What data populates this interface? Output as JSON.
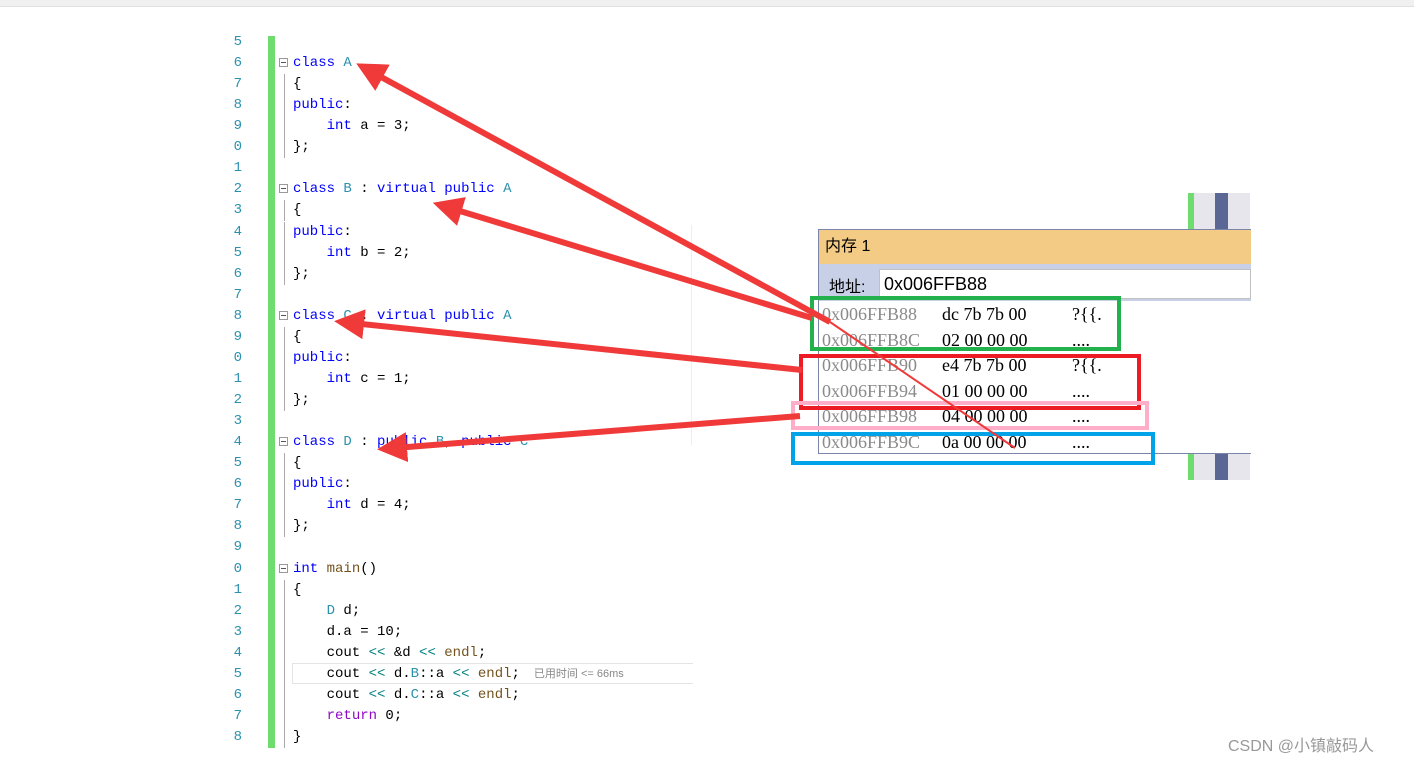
{
  "editor": {
    "lines": [
      {
        "n": "5",
        "html": ""
      },
      {
        "n": "6",
        "html": "<span class='kw'>class</span> <span class='ty'>A</span>",
        "fold": true
      },
      {
        "n": "7",
        "html": "{"
      },
      {
        "n": "8",
        "html": "<span class='kw'>public</span>:"
      },
      {
        "n": "9",
        "html": "    <span class='kw'>int</span> a = 3;"
      },
      {
        "n": "0",
        "html": "};"
      },
      {
        "n": "1",
        "html": ""
      },
      {
        "n": "2",
        "html": "<span class='kw'>class</span> <span class='ty'>B</span> : <span class='kw'>virtual</span> <span class='kw'>public</span> <span class='ty'>A</span>",
        "fold": true
      },
      {
        "n": "3",
        "html": "{"
      },
      {
        "n": "4",
        "html": "<span class='kw'>public</span>:"
      },
      {
        "n": "5",
        "html": "    <span class='kw'>int</span> b = 2;"
      },
      {
        "n": "6",
        "html": "};"
      },
      {
        "n": "7",
        "html": ""
      },
      {
        "n": "8",
        "html": "<span class='kw'>class</span> <span class='ty'>C</span> : <span class='kw'>virtual</span> <span class='kw'>public</span> <span class='ty'>A</span>",
        "fold": true
      },
      {
        "n": "9",
        "html": "{"
      },
      {
        "n": "0",
        "html": "<span class='kw'>public</span>:"
      },
      {
        "n": "1",
        "html": "    <span class='kw'>int</span> c = 1;"
      },
      {
        "n": "2",
        "html": "};"
      },
      {
        "n": "3",
        "html": ""
      },
      {
        "n": "4",
        "html": "<span class='kw'>class</span> <span class='ty'>D</span> : <span class='kw'>public</span> <span class='ty'>B</span>, <span class='kw'>public</span> <span class='ty'>C</span>",
        "fold": true
      },
      {
        "n": "5",
        "html": "{"
      },
      {
        "n": "6",
        "html": "<span class='kw'>public</span>:"
      },
      {
        "n": "7",
        "html": "    <span class='kw'>int</span> d = 4;"
      },
      {
        "n": "8",
        "html": "};"
      },
      {
        "n": "9",
        "html": ""
      },
      {
        "n": "0",
        "html": "<span class='kw'>int</span> <span class='fn'>main</span>()",
        "fold": true
      },
      {
        "n": "1",
        "html": "{"
      },
      {
        "n": "2",
        "html": "    <span class='ty'>D</span> d;"
      },
      {
        "n": "3",
        "html": "    d.a = 10;"
      },
      {
        "n": "4",
        "html": "    cout <span class='op'>&lt;&lt;</span> &amp;d <span class='op'>&lt;&lt;</span> <span class='fn'>endl</span>;"
      },
      {
        "n": "5",
        "html": "    cout <span class='op'>&lt;&lt;</span> d.<span class='ty'>B</span>::a <span class='op'>&lt;&lt;</span> <span class='fn'>endl</span>;",
        "hint": "已用时间 <= 66ms"
      },
      {
        "n": "6",
        "html": "    cout <span class='op'>&lt;&lt;</span> d.<span class='ty'>C</span>::a <span class='op'>&lt;&lt;</span> <span class='fn'>endl</span>;"
      },
      {
        "n": "7",
        "html": "    <span class='ctl'>return</span> 0;"
      },
      {
        "n": "8",
        "html": "}"
      }
    ]
  },
  "memory": {
    "title": "内存 1",
    "address_label": "地址:",
    "address_value": "0x006FFB88",
    "rows": [
      {
        "addr": "0x006FFB88",
        "hex": "dc 7b 7b 00",
        "text": "?{{."
      },
      {
        "addr": "0x006FFB8C",
        "hex": "02 00 00 00",
        "text": "...."
      },
      {
        "addr": "0x006FFB90",
        "hex": "e4 7b 7b 00",
        "text": "?{{."
      },
      {
        "addr": "0x006FFB94",
        "hex": "01 00 00 00",
        "text": "...."
      },
      {
        "addr": "0x006FFB98",
        "hex": "04 00 00 00",
        "text": "...."
      },
      {
        "addr": "0x006FFB9C",
        "hex": "0a 00 00 00",
        "text": "...."
      }
    ]
  },
  "annotation_colors": {
    "green": "#22b14c",
    "red": "#ed1c24",
    "pink": "#ffaec9",
    "blue": "#00a2e8",
    "arrow": "#f03a3a"
  },
  "watermark": "CSDN @小镇敲码人"
}
